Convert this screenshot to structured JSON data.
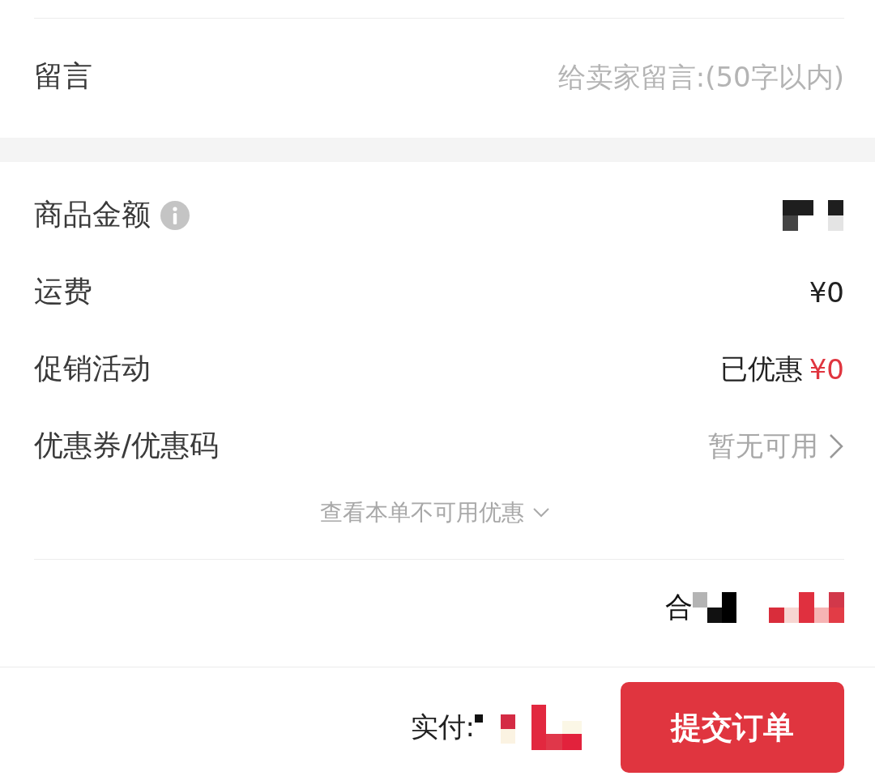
{
  "message": {
    "label": "留言",
    "placeholder": "给卖家留言:(50字以内)"
  },
  "rows": [
    {
      "kind": "info",
      "label": "商品金额"
    },
    {
      "kind": "plain",
      "label": "运费",
      "value": "¥0"
    },
    {
      "kind": "discount",
      "label": "促销活动",
      "value": "已优惠",
      "amount": "¥0"
    },
    {
      "kind": "link",
      "label": "优惠券/优惠码",
      "value": "暂无可用"
    }
  ],
  "unavailable_link": "查看本单不可用优惠",
  "total": {
    "label": "合"
  },
  "footer": {
    "paid_label": "实付:",
    "submit": "提交订单"
  }
}
